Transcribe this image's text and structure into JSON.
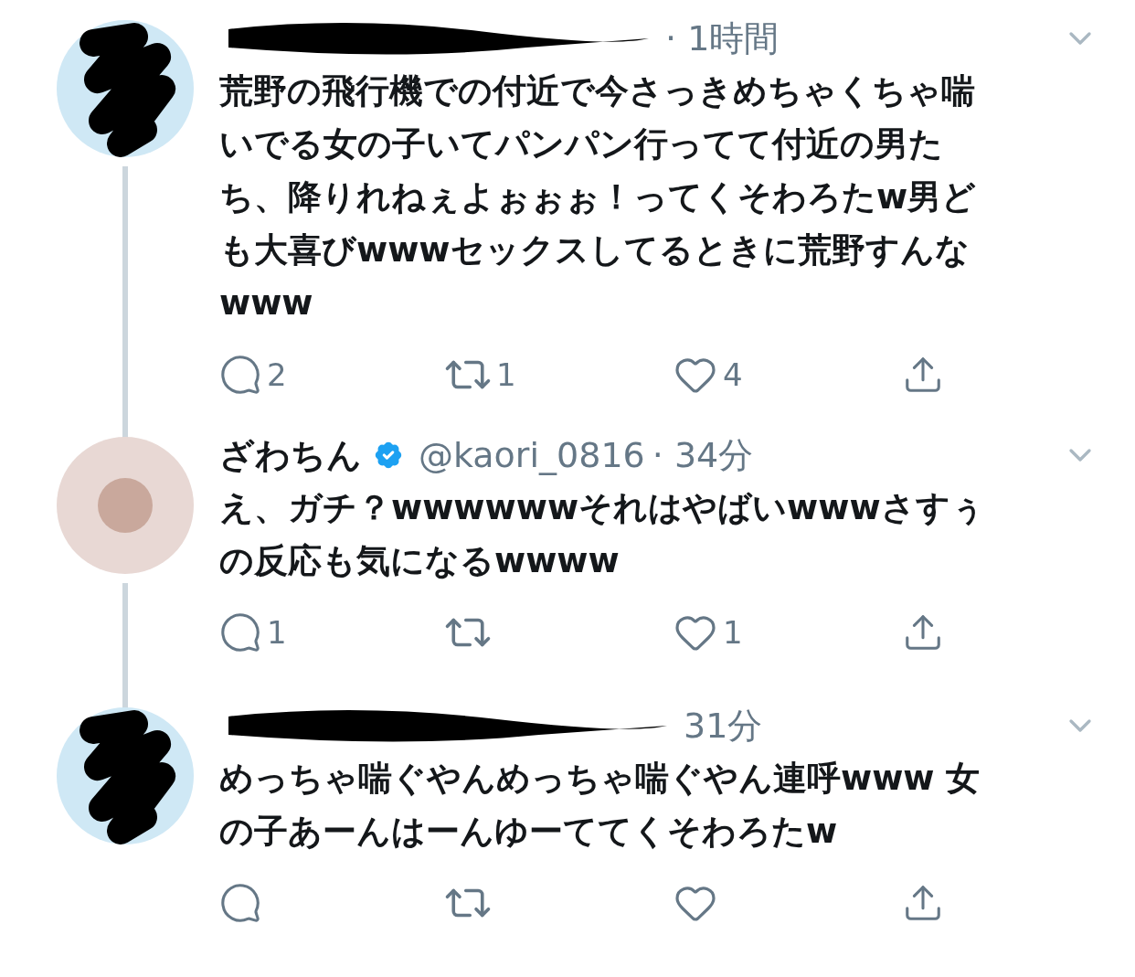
{
  "tweets": [
    {
      "redacted": true,
      "time": "· 1時間",
      "body_lines": [
        "荒野の飛行機での付近で今さっきめちゃくちゃ喘",
        "いでる女の子いてパンパン行ってて付近の男た",
        "ち、降りれねぇよぉぉぉ！ってくそわろたw男ど",
        "も大喜びwwwセックスしてるときに荒野すんな",
        "www"
      ],
      "replies": "2",
      "retweets": "1",
      "likes": "4"
    },
    {
      "redacted": false,
      "name": "ざわちん",
      "verified": true,
      "handle": "@kaori_0816",
      "time": "· 34分",
      "body_lines": [
        "え、ガチ？wwwwwwそれはやばいwwwさすぅ",
        "の反応も気になるwwww"
      ],
      "replies": "1",
      "likes": "1"
    },
    {
      "redacted": true,
      "time": "31分",
      "body_lines": [
        "めっちゃ喘ぐやんめっちゃ喘ぐやん連呼www 女",
        "の子あーんはーんゆーててくそわろたw"
      ]
    }
  ]
}
